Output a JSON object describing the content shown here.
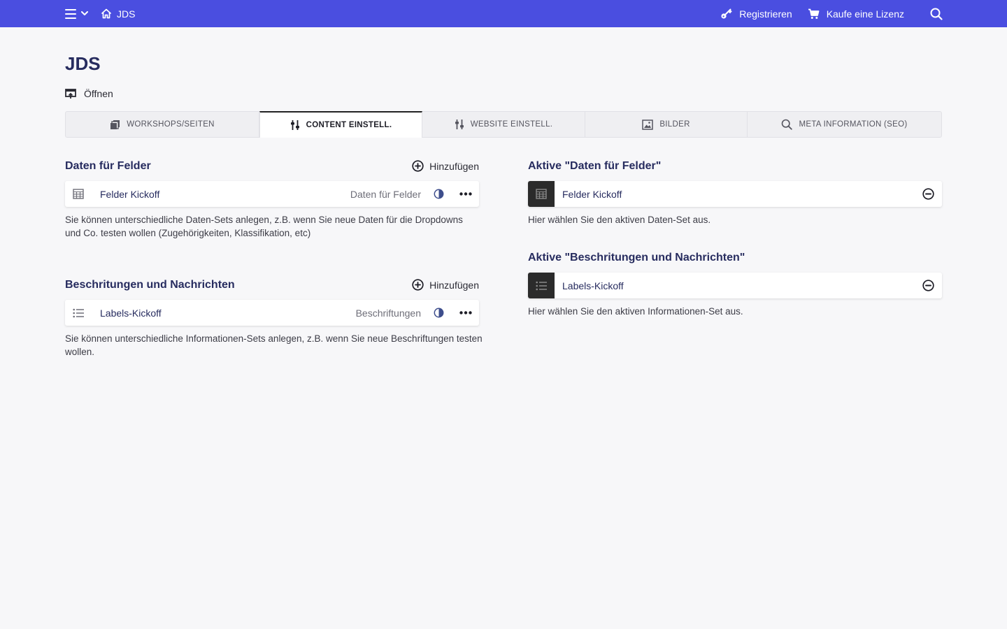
{
  "topbar": {
    "home_label": "JDS",
    "register_label": "Registrieren",
    "license_label": "Kaufe eine Lizenz",
    "bg_color": "#4a4ee0"
  },
  "page": {
    "title": "JDS",
    "open_label": "Öffnen"
  },
  "tabs": [
    {
      "label": "WORKSHOPS/SEITEN",
      "icon": "pages-icon",
      "active": false
    },
    {
      "label": "CONTENT EINSTELL.",
      "icon": "sliders-icon",
      "active": true
    },
    {
      "label": "WEBSITE EINSTELL.",
      "icon": "sliders-icon",
      "active": false
    },
    {
      "label": "BILDER",
      "icon": "image-icon",
      "active": false
    },
    {
      "label": "META INFORMATION (SEO)",
      "icon": "search-icon",
      "active": false
    }
  ],
  "left": {
    "data_section": {
      "title": "Daten für Felder",
      "add_label": "Hinzufügen",
      "item": {
        "name": "Felder Kickoff",
        "type": "Daten für Felder",
        "icon": "table-icon"
      },
      "help": "Sie können unterschiedliche Daten-Sets anlegen, z.B. wenn Sie neue Daten für die Dropdowns und Co. testen wollen (Zugehörigkeiten, Klassifikation, etc)"
    },
    "labels_section": {
      "title": "Beschritungen und Nachrichten",
      "add_label": "Hinzufügen",
      "item": {
        "name": "Labels-Kickoff",
        "type": "Beschriftungen",
        "icon": "list-icon"
      },
      "help": "Sie können unterschiedliche Informationen-Sets anlegen, z.B. wenn Sie neue Beschriftungen testen wollen."
    }
  },
  "right": {
    "active_data": {
      "title": "Aktive \"Daten für Felder\"",
      "item_name": "Felder Kickoff",
      "help": "Hier wählen Sie den aktiven Daten-Set aus."
    },
    "active_labels": {
      "title": "Aktive \"Beschritungen und Nachrichten\"",
      "item_name": "Labels-Kickoff",
      "help": "Hier wählen Sie den aktiven Informationen-Set aus."
    }
  }
}
